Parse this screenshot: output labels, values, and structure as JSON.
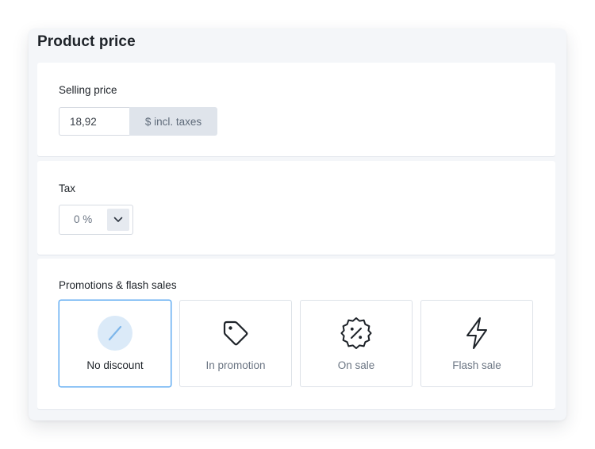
{
  "title": "Product price",
  "selling_price": {
    "label": "Selling price",
    "value": "18,92",
    "addon": "$ incl. taxes"
  },
  "tax": {
    "label": "Tax",
    "value": "0 %"
  },
  "promotions": {
    "label": "Promotions & flash sales",
    "options": [
      {
        "label": "No discount",
        "icon": "no-discount-icon",
        "selected": true
      },
      {
        "label": "In promotion",
        "icon": "tag-icon",
        "selected": false
      },
      {
        "label": "On sale",
        "icon": "percent-badge-icon",
        "selected": false
      },
      {
        "label": "Flash sale",
        "icon": "lightning-icon",
        "selected": false
      }
    ]
  },
  "colors": {
    "selected_border": "#64aef2",
    "selected_icon_bg": "#dbeaf8",
    "addon_bg": "#dfe4eb"
  }
}
